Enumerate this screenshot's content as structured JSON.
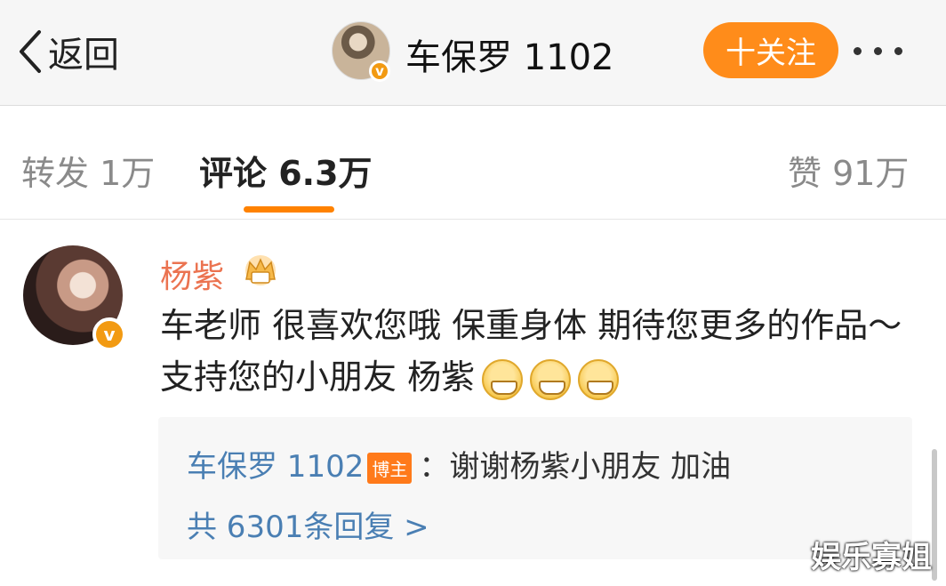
{
  "header": {
    "back_label": "返回",
    "user_name": "车保罗 1102",
    "follow_label": "十关注"
  },
  "tabs": {
    "repost": "转发 1万",
    "comment": "评论 6.3万",
    "like": "赞 91万"
  },
  "comment": {
    "author": "杨紫",
    "text": "车老师 很喜欢您哦 保重身体 期待您更多的作品～支持您的小朋友 杨紫",
    "emoji_count": 3,
    "reply": {
      "author": "车保罗 1102",
      "badge": "博主",
      "text": "：谢谢杨紫小朋友 加油",
      "more": "共 6301条回复 >"
    }
  },
  "watermark": "娱乐寡姐",
  "colors": {
    "accent": "#ff8200",
    "follow_button": "#ff8c1a",
    "author_name": "#eb7350",
    "link_blue": "#4a7fb3",
    "verified": "#f29a12"
  },
  "icons": [
    "chevron-left-icon",
    "verified-icon",
    "more-icon",
    "crown-badge-icon",
    "grin-emoji-icon"
  ]
}
